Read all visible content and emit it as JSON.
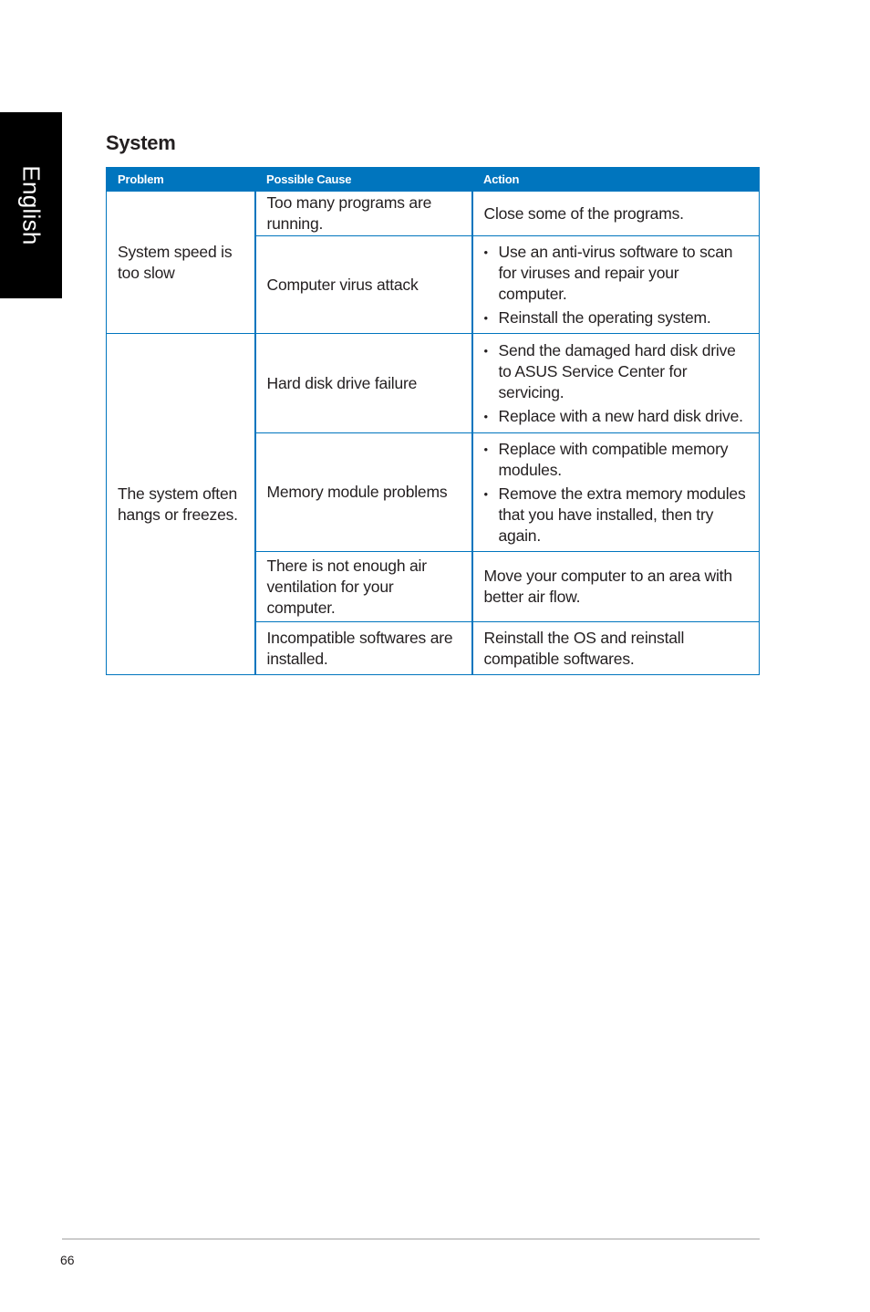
{
  "side_tab": {
    "label": "English"
  },
  "section": {
    "title": "System"
  },
  "table": {
    "headers": [
      "Problem",
      "Possible Cause",
      "Action"
    ],
    "groups": [
      {
        "problem": "System speed is too slow",
        "rows": [
          {
            "cause": "Too many programs are running.",
            "action": "Close some of the programs."
          },
          {
            "cause": "Computer virus attack",
            "actions": [
              "Use an anti-virus software to scan for viruses and repair your computer.",
              "Reinstall the operating system."
            ]
          }
        ]
      },
      {
        "problem": "The system often hangs or freezes.",
        "rows": [
          {
            "cause": "Hard disk drive failure",
            "actions": [
              "Send the damaged hard disk drive to ASUS Service Center for servicing.",
              "Replace with a new hard disk drive."
            ]
          },
          {
            "cause": "Memory module problems",
            "actions": [
              "Replace with compatible memory modules.",
              "Remove the extra memory modules that you have installed, then try again."
            ]
          },
          {
            "cause": "There is not enough air ventilation for your computer.",
            "action": "Move your computer to an area with better air flow."
          },
          {
            "cause": "Incompatible softwares are installed.",
            "action": "Reinstall the OS and reinstall compatible softwares."
          }
        ]
      }
    ]
  },
  "footer": {
    "page_number": "66"
  },
  "colors": {
    "header_blue": "#0075be",
    "tab_black": "#000000"
  }
}
